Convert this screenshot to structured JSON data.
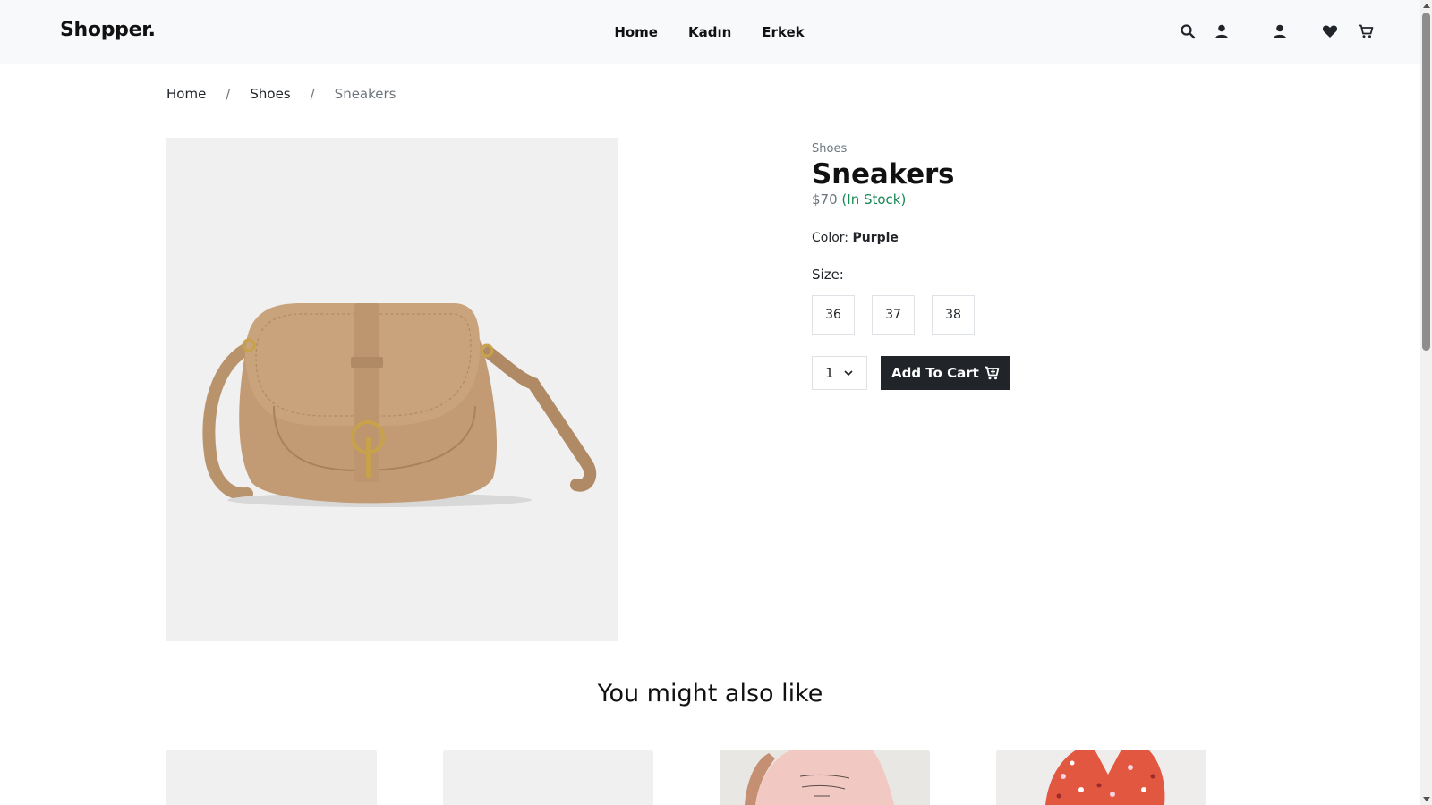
{
  "header": {
    "brand": "Shopper.",
    "nav": [
      "Home",
      "Kadın",
      "Erkek"
    ],
    "icons": [
      "search-icon",
      "user-icon",
      "user-account-icon",
      "heart-icon",
      "cart-icon"
    ]
  },
  "breadcrumb": {
    "items": [
      "Home",
      "Shoes"
    ],
    "current": "Sneakers",
    "separator": "/"
  },
  "product": {
    "category": "Shoes",
    "name": "Sneakers",
    "price": "$70",
    "stock": "(In Stock)",
    "color_label": "Color:",
    "color_value": "Purple",
    "size_label": "Size:",
    "sizes": [
      "36",
      "37",
      "38"
    ],
    "quantity": "1",
    "add_to_cart": "Add To Cart",
    "image": "tan-crossbody-bag"
  },
  "related": {
    "title": "You might also like"
  },
  "colors": {
    "header_bg": "#f8f9fa",
    "button_dark": "#212529",
    "stock_green": "#198754",
    "muted": "#6c757d"
  }
}
